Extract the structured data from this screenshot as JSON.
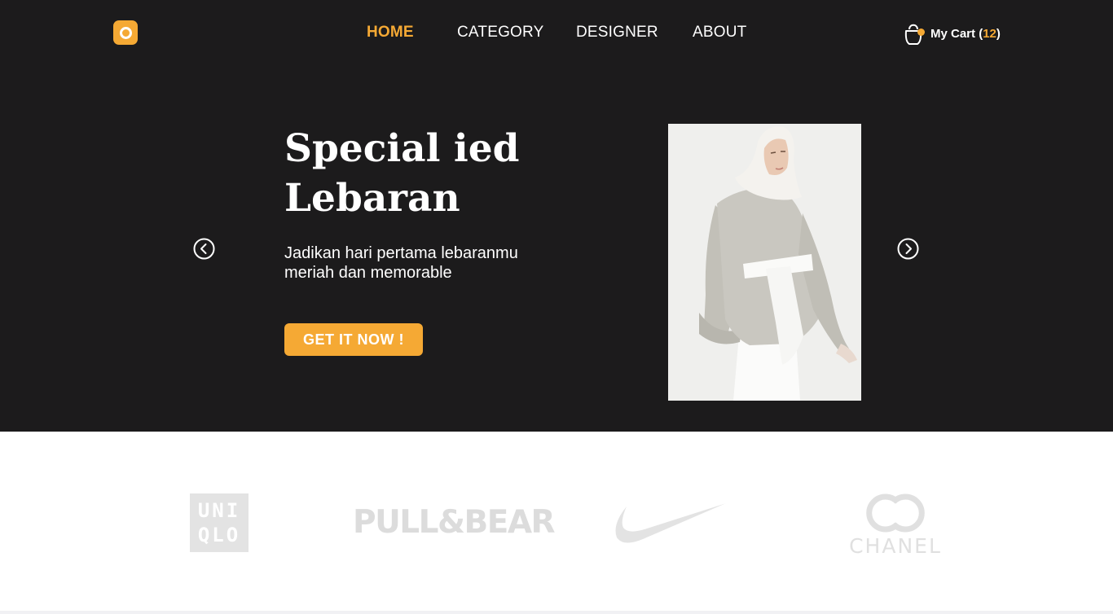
{
  "header": {
    "logo_icon": "ring-logo-icon",
    "nav": [
      {
        "label": "HOME",
        "active": true
      },
      {
        "label": "CATEGORY",
        "active": false
      },
      {
        "label": "DESIGNER",
        "active": false
      },
      {
        "label": "ABOUT",
        "active": false
      }
    ],
    "cart": {
      "icon": "shopping-bag-icon",
      "label": "My Cart",
      "open_paren": "(",
      "count": "12",
      "close_paren": ")"
    }
  },
  "hero": {
    "title_line1": "Special ied",
    "title_line2": "Lebaran",
    "subtitle_line1": "Jadikan hari pertama lebaranmu",
    "subtitle_line2": "meriah dan memorable",
    "cta_label": "GET IT NOW !",
    "prev_icon": "chevron-left-circle-icon",
    "next_icon": "chevron-right-circle-icon",
    "image": "model-wearing-grey-tunic-and-hijab"
  },
  "brands": {
    "uniqlo_line1": "UNI",
    "uniqlo_line2": "QLO",
    "pullbear": "PULL&BEAR",
    "nike_icon": "nike-swoosh-logo",
    "chanel": "CHANEL"
  },
  "colors": {
    "hero_bg": "#1c1b1c",
    "accent": "#f5a934",
    "text_light": "#ffffff",
    "brand_grey": "#dcdcdc"
  }
}
